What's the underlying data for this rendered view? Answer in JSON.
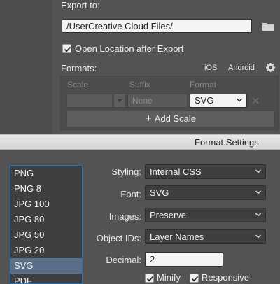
{
  "export": {
    "label": "Export to:",
    "path": "/UserCreative Cloud Files/",
    "open_location_label": "Open Location after Export",
    "open_location_checked": true
  },
  "formats": {
    "label": "Formats:",
    "ios_label": "iOS",
    "android_label": "Android",
    "columns": [
      "Scale",
      "Suffix",
      "Format"
    ],
    "row": {
      "scale": "",
      "suffix_placeholder": "None",
      "format": "SVG"
    },
    "add_scale_label": "Add Scale"
  },
  "dialog": {
    "title": "Format Settings",
    "format_list": [
      "PNG",
      "PNG 8",
      "JPG 100",
      "JPG 80",
      "JPG 50",
      "JPG 20",
      "SVG",
      "PDF"
    ],
    "selected_format": "SVG",
    "fields": {
      "styling": {
        "label": "Styling:",
        "value": "Internal CSS"
      },
      "font": {
        "label": "Font:",
        "value": "SVG"
      },
      "images": {
        "label": "Images:",
        "value": "Preserve"
      },
      "object_ids": {
        "label": "Object IDs:",
        "value": "Layer Names"
      },
      "decimal": {
        "label": "Decimal:",
        "value": "2"
      }
    },
    "minify_label": "Minify",
    "minify_checked": true,
    "responsive_label": "Responsive",
    "responsive_checked": true
  },
  "colors": {
    "panel_bg": "#535353",
    "selection_bg": "#5b6e87",
    "focus_border": "#1d75c8"
  }
}
